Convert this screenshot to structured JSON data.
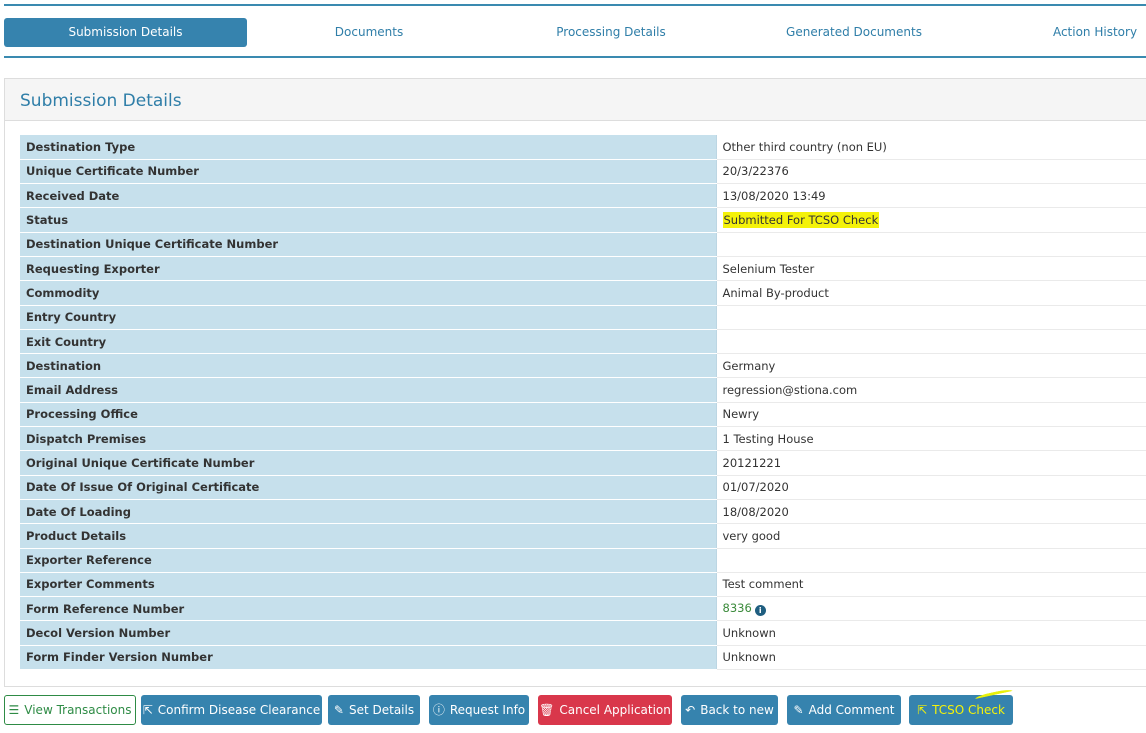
{
  "tabs": [
    {
      "label": "Submission Details",
      "active": true
    },
    {
      "label": "Documents",
      "active": false
    },
    {
      "label": "Processing Details",
      "active": false
    },
    {
      "label": "Generated Documents",
      "active": false
    },
    {
      "label": "Action History",
      "active": false
    }
  ],
  "panel": {
    "title": "Submission Details"
  },
  "details": [
    {
      "label": "Destination Type",
      "value": "Other third country (non EU)"
    },
    {
      "label": "Unique Certificate Number",
      "value": "20/3/22376"
    },
    {
      "label": "Received Date",
      "value": "13/08/2020 13:49"
    },
    {
      "label": "Status",
      "value": "Submitted For TCSO Check"
    },
    {
      "label": "Destination Unique Certificate Number",
      "value": ""
    },
    {
      "label": "Requesting Exporter",
      "value": "Selenium Tester"
    },
    {
      "label": "Commodity",
      "value": "Animal By-product"
    },
    {
      "label": "Entry Country",
      "value": ""
    },
    {
      "label": "Exit Country",
      "value": ""
    },
    {
      "label": "Destination",
      "value": "Germany"
    },
    {
      "label": "Email Address",
      "value": "regression@stiona.com"
    },
    {
      "label": "Processing Office",
      "value": "Newry"
    },
    {
      "label": "Dispatch Premises",
      "value": "1 Testing House"
    },
    {
      "label": "Original Unique Certificate Number",
      "value": "20121221"
    },
    {
      "label": "Date Of Issue Of Original Certificate",
      "value": "01/07/2020"
    },
    {
      "label": "Date Of Loading",
      "value": "18/08/2020"
    },
    {
      "label": "Product Details",
      "value": "very good"
    },
    {
      "label": "Exporter Reference",
      "value": ""
    },
    {
      "label": "Exporter Comments",
      "value": "Test comment"
    },
    {
      "label": "Form Reference Number",
      "value": "8336"
    },
    {
      "label": "Decol Version Number",
      "value": "Unknown"
    },
    {
      "label": "Form Finder Version Number",
      "value": "Unknown"
    }
  ],
  "actions": {
    "view_transactions": "View Transactions",
    "confirm_disease_clearance": "Confirm Disease Clearance",
    "set_details": "Set Details",
    "request_info": "Request Info",
    "cancel_application": "Cancel Application",
    "back_to_new": "Back to new",
    "add_comment": "Add Comment",
    "tcso_check": "TCSO Check"
  },
  "colors": {
    "primary": "#3683ae",
    "danger": "#d9374b",
    "success_outline": "#2e8b45",
    "label_bg": "#c6e0ec",
    "highlight": "#f4f20a"
  }
}
